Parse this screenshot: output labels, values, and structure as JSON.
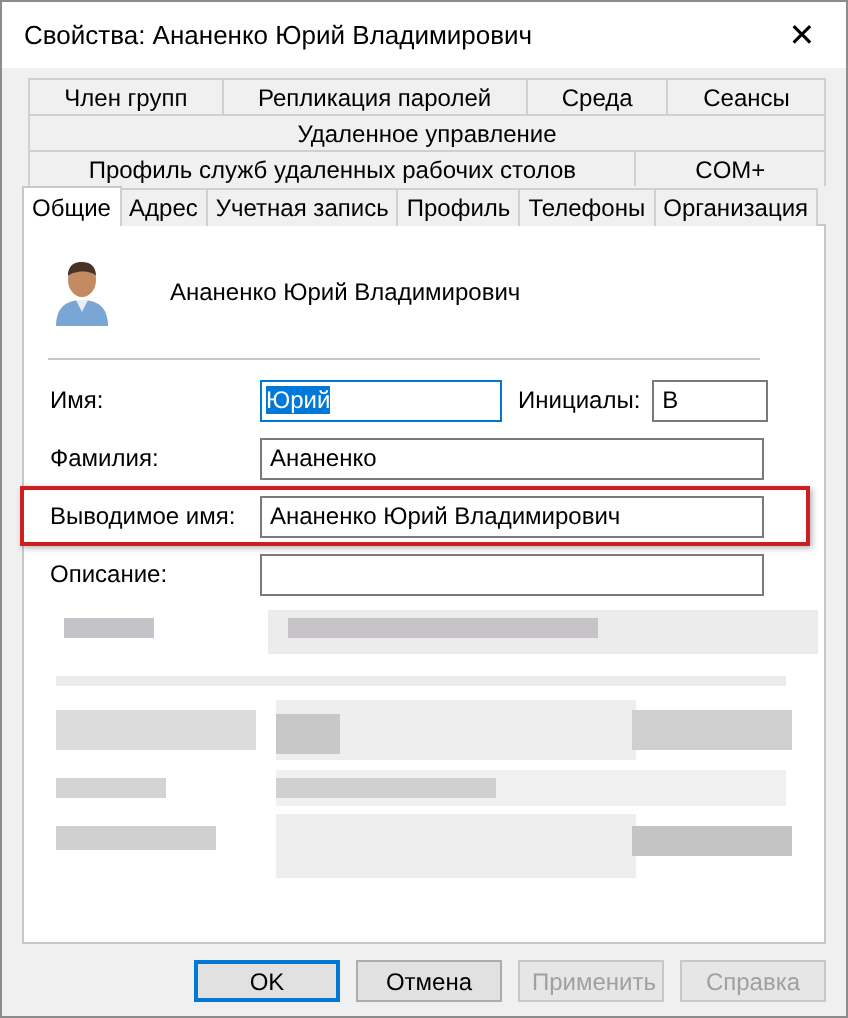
{
  "window": {
    "title": "Свойства: Ананенко Юрий Владимирович",
    "close": "✕"
  },
  "tab_rows": [
    [
      {
        "label": "Член групп",
        "selected": false
      },
      {
        "label": "Репликация паролей",
        "selected": false
      },
      {
        "label": "Среда",
        "selected": false
      },
      {
        "label": "Сеансы",
        "selected": false
      }
    ],
    [
      {
        "label": "Удаленное управление",
        "selected": false
      }
    ],
    [
      {
        "label": "Профиль служб удаленных рабочих столов",
        "selected": false
      },
      {
        "label": "COM+",
        "selected": false
      }
    ],
    [
      {
        "label": "Общие",
        "selected": true
      },
      {
        "label": "Адрес",
        "selected": false
      },
      {
        "label": "Учетная запись",
        "selected": false
      },
      {
        "label": "Профиль",
        "selected": false
      },
      {
        "label": "Телефоны",
        "selected": false
      },
      {
        "label": "Организация",
        "selected": false
      }
    ]
  ],
  "user_name": "Ананенко Юрий Владимирович",
  "fields": {
    "first_name": {
      "label": "Имя:",
      "value": "Юрий",
      "text_selected": true
    },
    "initials": {
      "label": "Инициалы:",
      "value": "В"
    },
    "last_name": {
      "label": "Фамилия:",
      "value": "Ананенко"
    },
    "display_name": {
      "label": "Выводимое имя:",
      "value": "Ананенко Юрий Владимирович",
      "highlighted": true
    },
    "description": {
      "label": "Описание:"
    }
  },
  "buttons": [
    {
      "label": "OK",
      "disabled": false,
      "default": true
    },
    {
      "label": "Отмена",
      "disabled": false,
      "default": false
    },
    {
      "label": "Применить",
      "disabled": true,
      "default": false
    },
    {
      "label": "Справка",
      "disabled": true,
      "default": false
    }
  ]
}
